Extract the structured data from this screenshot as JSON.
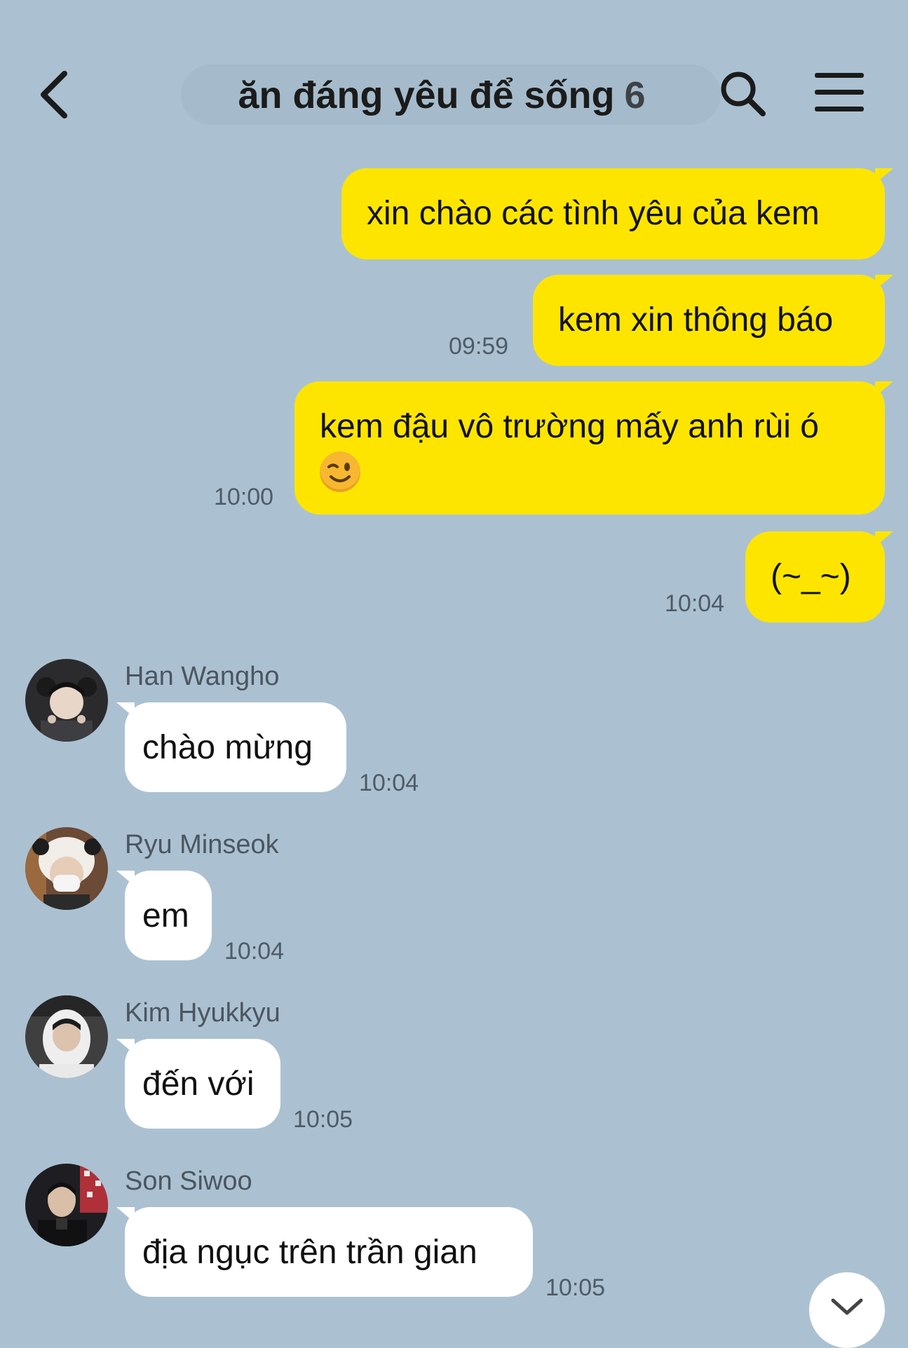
{
  "header": {
    "title": "ăn đáng yêu để sống",
    "member_count": "6",
    "back_icon": "chevron-left-icon",
    "search_icon": "search-icon",
    "menu_icon": "hamburger-menu-icon"
  },
  "colors": {
    "background": "#abc1d1",
    "my_bubble": "#fee500",
    "other_bubble": "#ffffff"
  },
  "messages": [
    {
      "text": "xin chào các tình yêu của kem"
    },
    {
      "text": "kem xin thông báo",
      "time": "09:59"
    },
    {
      "line1": "kem đậu vô trường mấy anh rùi ó",
      "emoji": "winking-face-emoji",
      "time": "10:00"
    },
    {
      "text": "(~_~)",
      "time": "10:04"
    },
    {
      "sender": "Han Wangho",
      "text": "chào mừng",
      "time": "10:04"
    },
    {
      "sender": "Ryu Minseok",
      "text": "em",
      "time": "10:04"
    },
    {
      "sender": "Kim Hyukkyu",
      "text": "đến với",
      "time": "10:05"
    },
    {
      "sender": "Son Siwoo",
      "text": "địa ngục trên trần gian",
      "time": "10:05"
    }
  ],
  "scroll_down_icon": "chevron-down-icon"
}
